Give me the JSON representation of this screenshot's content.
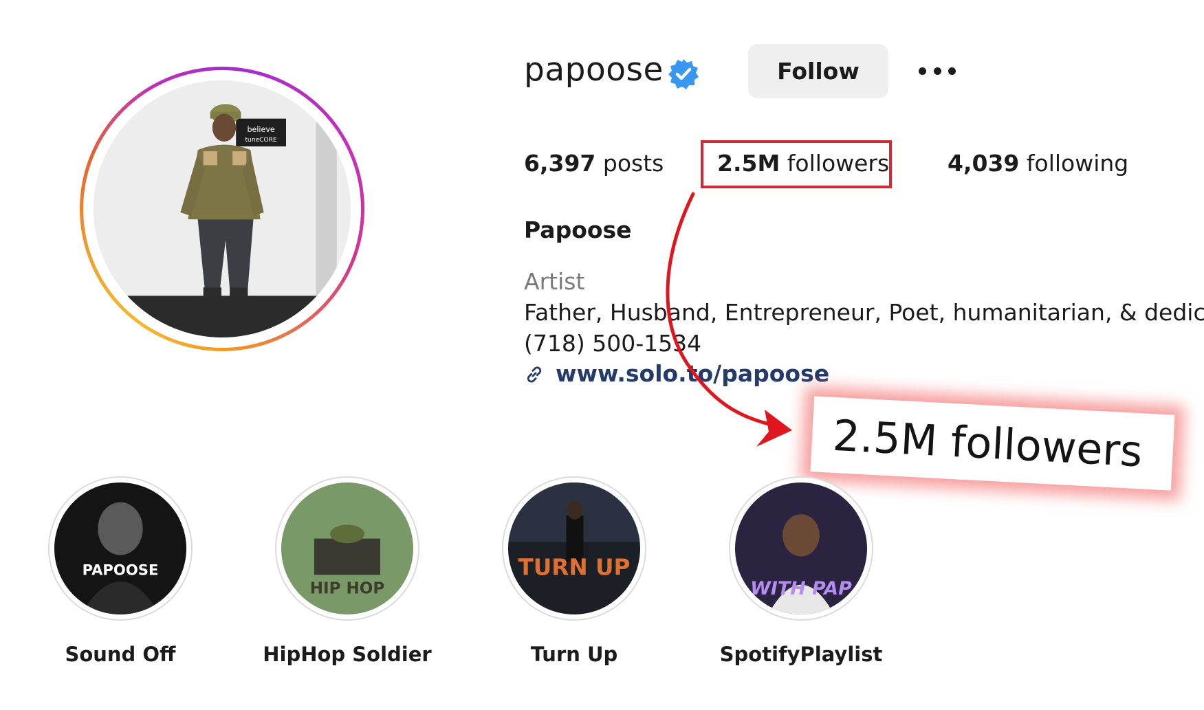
{
  "profile": {
    "username": "papoose",
    "verified": true,
    "follow_label": "Follow",
    "more_icon": "more-options-icon"
  },
  "stats": {
    "posts_count": "6,397",
    "posts_label": " posts",
    "followers_count": "2.5M",
    "followers_label": " followers",
    "following_count": "4,039",
    "following_label": " following"
  },
  "bio": {
    "full_name": "Papoose",
    "category": "Artist",
    "text": "Father, Husband, Entrepreneur, Poet, humanitarian, & dedicated",
    "phone": "(718) 500-1534",
    "link": "www.solo.to/papoose"
  },
  "callout": {
    "text": "2.5M followers"
  },
  "highlights": [
    {
      "label": "Sound Off",
      "cover_text": "PAPOOSE"
    },
    {
      "label": "HipHop Soldier",
      "cover_text": "HIP HOP"
    },
    {
      "label": "Turn Up",
      "cover_text": "TURN UP"
    },
    {
      "label": "SpotifyPlaylist",
      "cover_text": "WITH PAP"
    }
  ],
  "colors": {
    "highlight_box": "#d42a36",
    "link": "#233a6b",
    "verified_badge": "#3897f0",
    "follow_button_bg": "#efefef"
  }
}
